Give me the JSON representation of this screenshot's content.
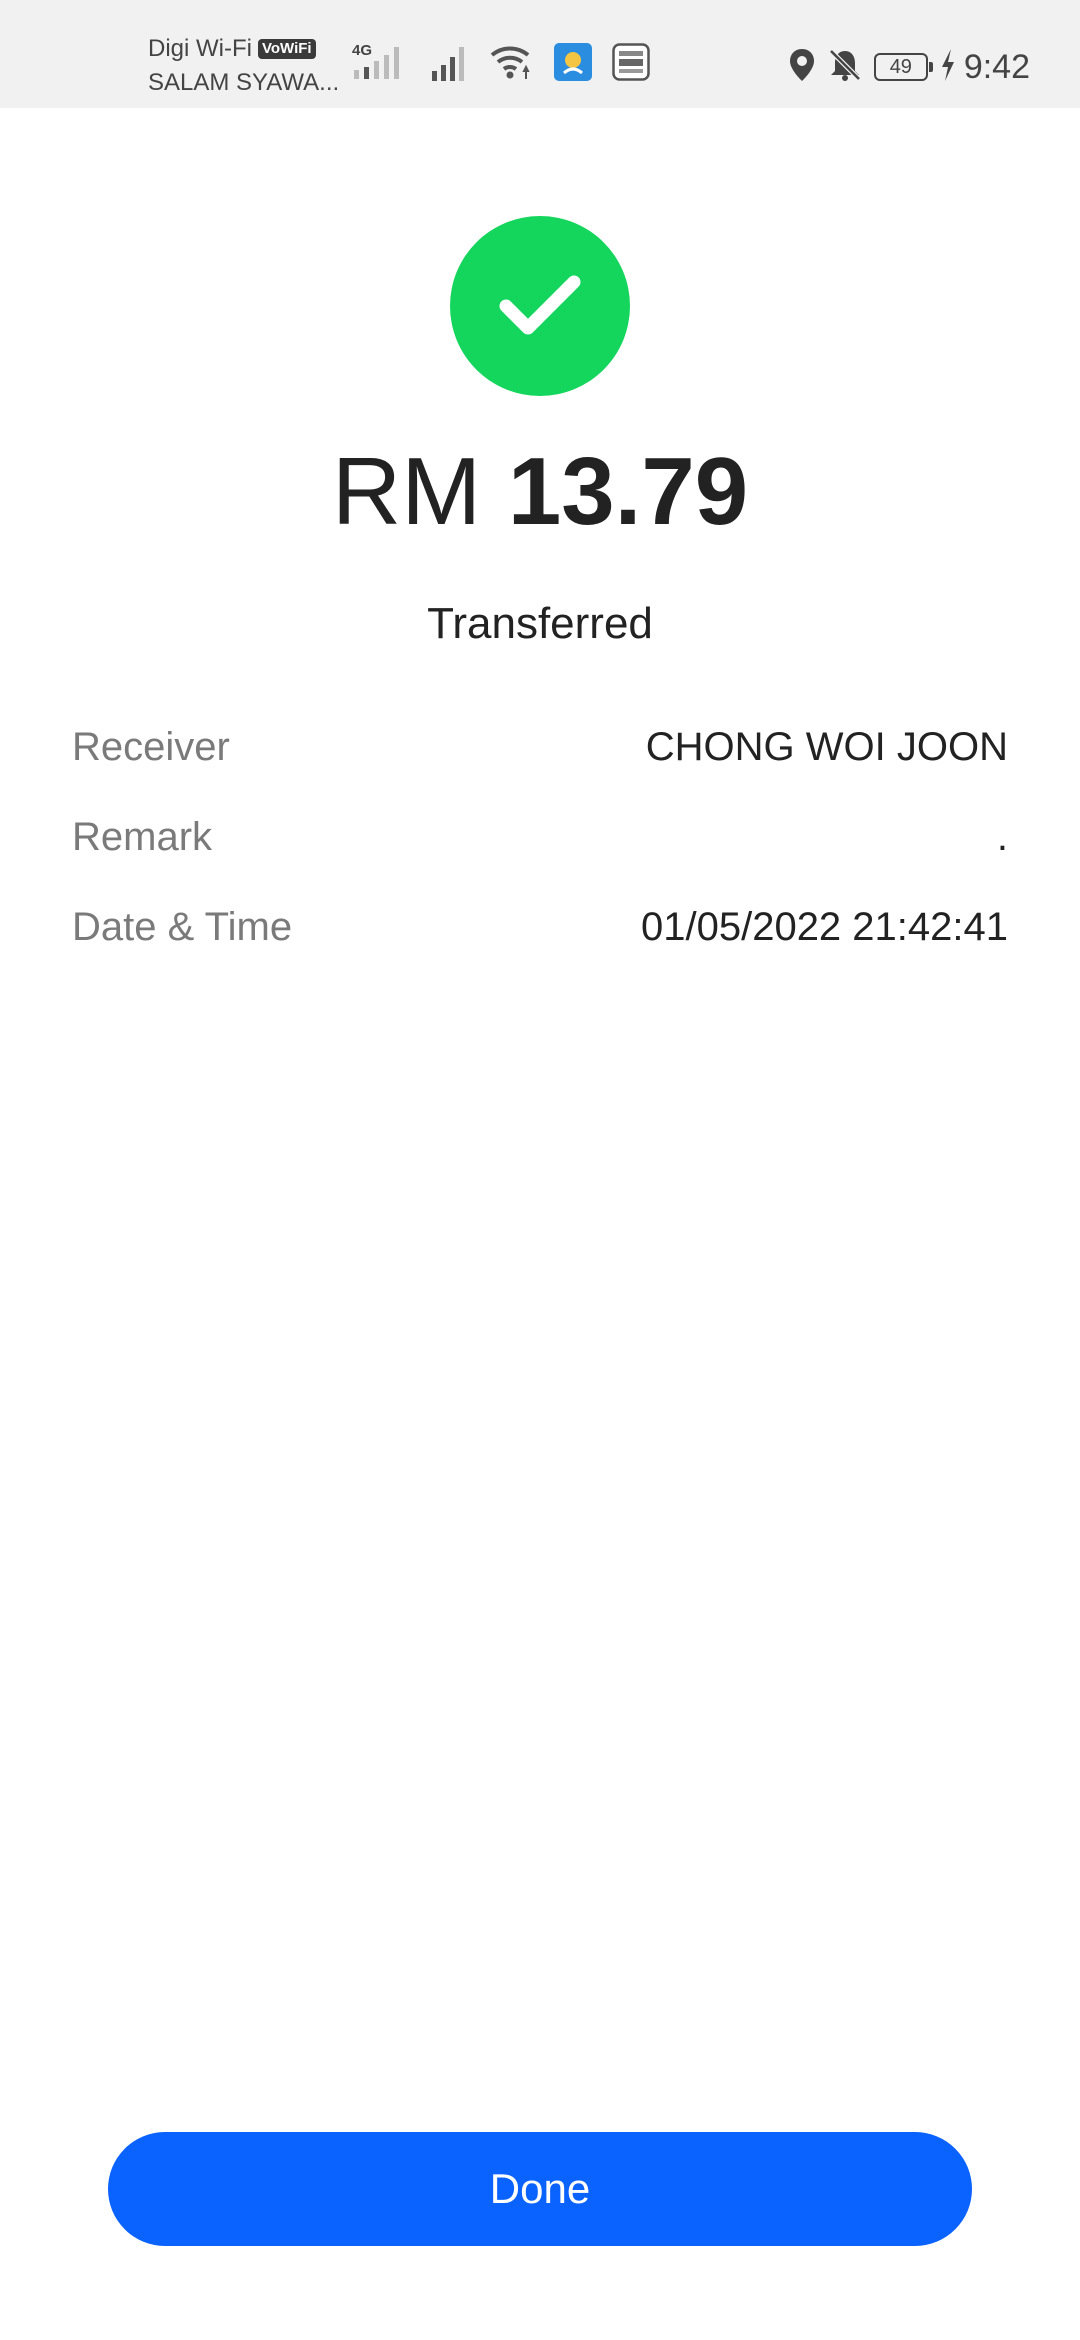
{
  "status_bar": {
    "carrier_line1": "Digi Wi-Fi",
    "carrier_badge": "VoWiFi",
    "carrier_line2": "SALAM SYAWA...",
    "network_type": "4G",
    "battery_level": "49",
    "time": "9:42",
    "icons": [
      "signal-4g-icon",
      "signal-icon",
      "wifi-icon",
      "app-notification-icon",
      "tng-ewallet-icon",
      "location-icon",
      "mute-bell-icon",
      "battery-icon",
      "charging-icon"
    ]
  },
  "result": {
    "icon": "check-icon",
    "currency": "RM",
    "amount": "13.79",
    "status": "Transferred",
    "accent_color": "#14d65c"
  },
  "details": [
    {
      "label": "Receiver",
      "value": "CHONG WOI JOON"
    },
    {
      "label": "Remark",
      "value": "."
    },
    {
      "label": "Date & Time",
      "value": "01/05/2022 21:42:41"
    }
  ],
  "actions": {
    "done_label": "Done",
    "button_color": "#0a62ff"
  }
}
